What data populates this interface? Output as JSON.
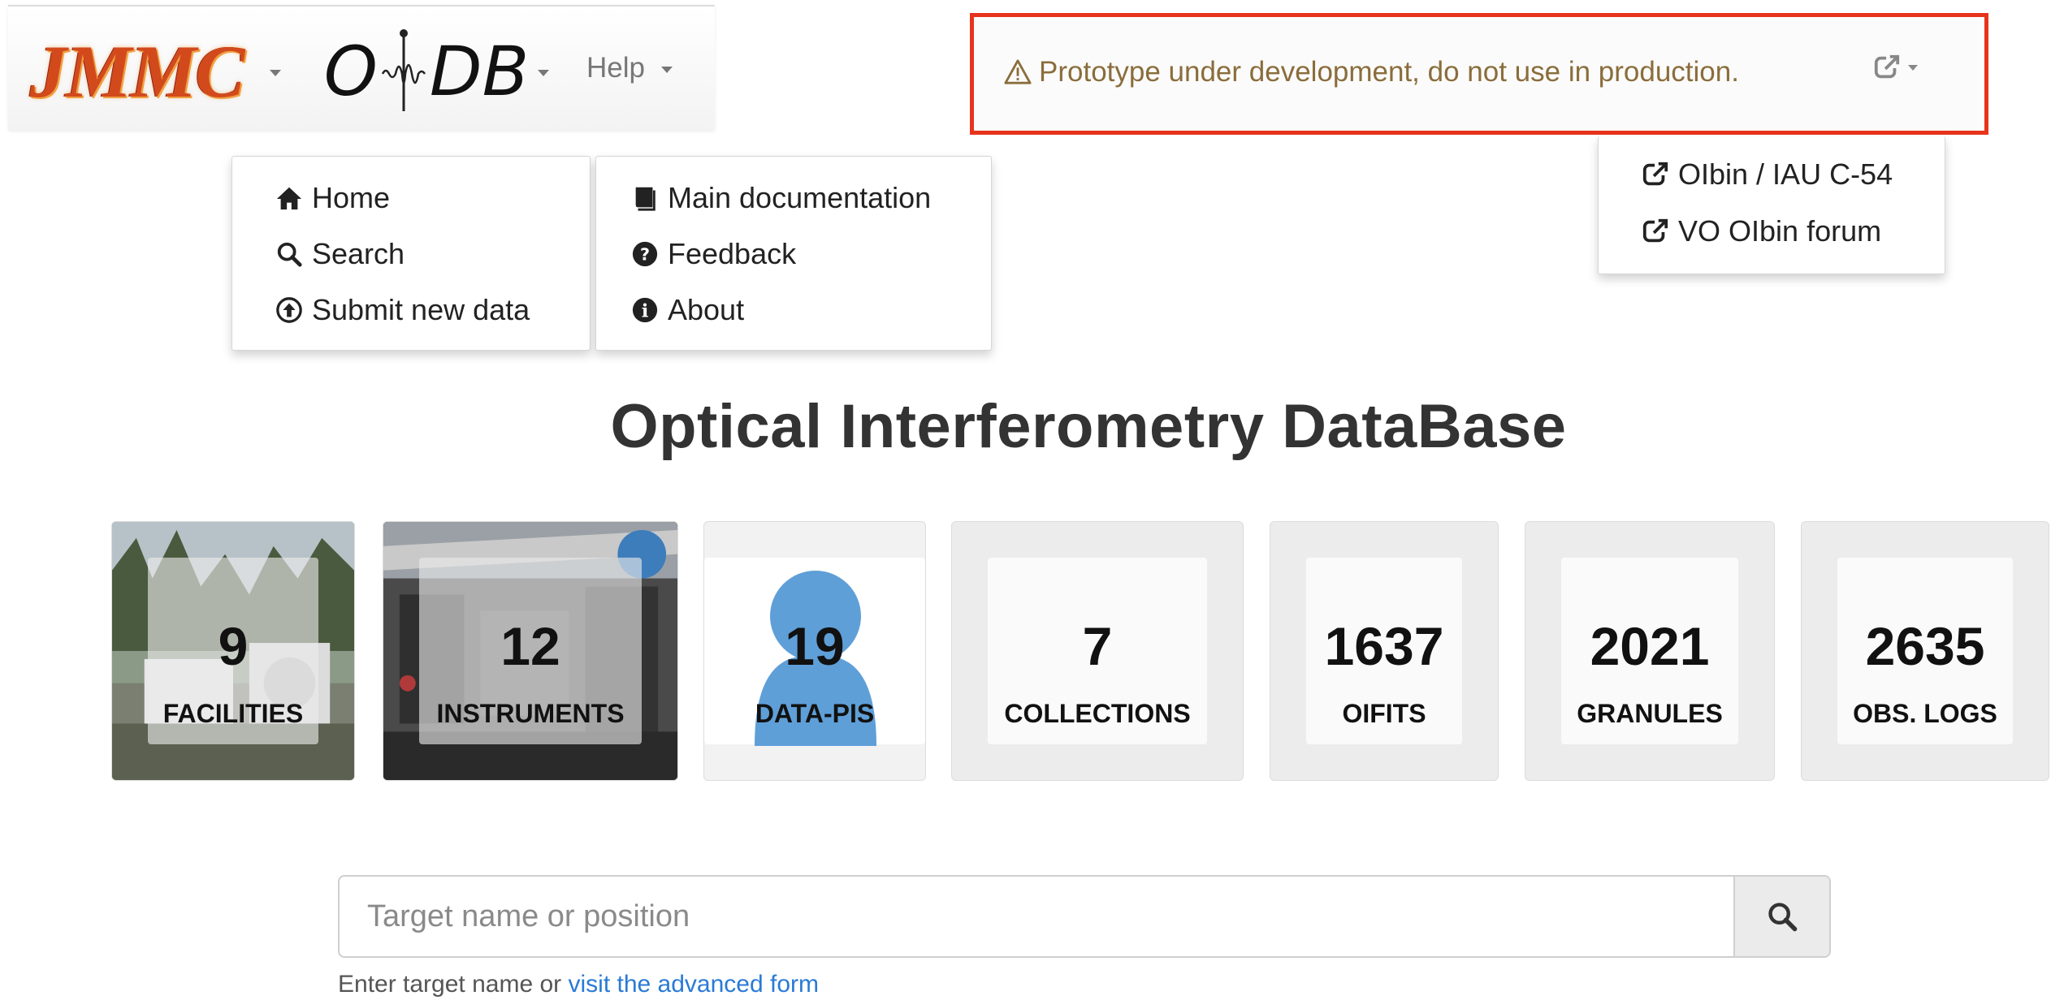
{
  "navbar": {
    "brand_jmmc": "JMMC",
    "brand_oidb_left": "O",
    "brand_oidb_right": "DB",
    "help_label": "Help"
  },
  "warning": {
    "text": "Prototype under development, do not use in production."
  },
  "oidb_menu": {
    "items": [
      {
        "icon": "home-icon",
        "label": "Home"
      },
      {
        "icon": "search-icon",
        "label": "Search"
      },
      {
        "icon": "upload-icon",
        "label": "Submit new data"
      }
    ]
  },
  "help_menu": {
    "items": [
      {
        "icon": "book-icon",
        "label": "Main documentation"
      },
      {
        "icon": "question-icon",
        "label": "Feedback"
      },
      {
        "icon": "info-icon",
        "label": "About"
      }
    ]
  },
  "external_menu": {
    "items": [
      {
        "icon": "external-link-icon",
        "label": "OIbin / IAU C-54"
      },
      {
        "icon": "external-link-icon",
        "label": "VO OIbin forum"
      }
    ]
  },
  "page_title": "Optical Interferometry DataBase",
  "stats": [
    {
      "value": "9",
      "label": "FACILITIES"
    },
    {
      "value": "12",
      "label": "INSTRUMENTS"
    },
    {
      "value": "19",
      "label": "DATA-PIS"
    },
    {
      "value": "7",
      "label": "COLLECTIONS"
    },
    {
      "value": "1637",
      "label": "OIFITS"
    },
    {
      "value": "2021",
      "label": "GRANULES"
    },
    {
      "value": "2635",
      "label": "OBS. LOGS"
    }
  ],
  "search": {
    "placeholder": "Target name or position",
    "help_prefix": "Enter target name or",
    "help_link": "visit the advanced form"
  },
  "colors": {
    "warning_border": "#e8331c",
    "warning_text": "#8a6d3b",
    "link": "#2a7ad6",
    "jmmc_brand": "#d24a1c"
  }
}
